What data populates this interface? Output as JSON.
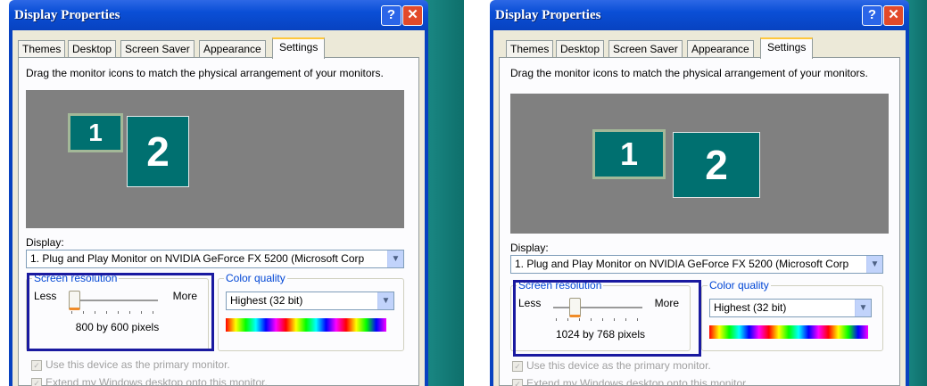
{
  "panels": [
    {
      "window": {
        "title": "Display Properties",
        "help_glyph": "?",
        "close_glyph": "✕"
      },
      "tabs": [
        "Themes",
        "Desktop",
        "Screen Saver",
        "Appearance",
        "Settings"
      ],
      "active_tab": "Settings",
      "instruction": "Drag the monitor icons to match the physical arrangement of your monitors.",
      "monitors": [
        "1",
        "2"
      ],
      "display_label": "Display:",
      "display_value": "1. Plug and Play Monitor on NVIDIA GeForce FX 5200  (Microsoft Corp",
      "screen_resolution": {
        "label": "Screen resolution",
        "less": "Less",
        "more": "More",
        "value": "800 by 600 pixels",
        "slider_fraction": 0.0
      },
      "color_quality": {
        "label": "Color quality",
        "value": "Highest (32 bit)"
      },
      "checkboxes": [
        "Use this device as the primary monitor.",
        "Extend my Windows desktop onto this monitor."
      ]
    },
    {
      "window": {
        "title": "Display Properties",
        "help_glyph": "?",
        "close_glyph": "✕"
      },
      "tabs": [
        "Themes",
        "Desktop",
        "Screen Saver",
        "Appearance",
        "Settings"
      ],
      "active_tab": "Settings",
      "instruction": "Drag the monitor icons to match the physical arrangement of your monitors.",
      "monitors": [
        "1",
        "2"
      ],
      "display_label": "Display:",
      "display_value": "1. Plug and Play Monitor on NVIDIA GeForce FX 5200  (Microsoft Corp",
      "screen_resolution": {
        "label": "Screen resolution",
        "less": "Less",
        "more": "More",
        "value": "1024 by 768 pixels",
        "slider_fraction": 0.2
      },
      "color_quality": {
        "label": "Color quality",
        "value": "Highest (32 bit)"
      },
      "checkboxes": [
        "Use this device as the primary monitor.",
        "Extend my Windows desktop onto this monitor."
      ]
    }
  ],
  "colors": {
    "titlebar": "#0a4fd6",
    "highlight": "#1a1aa0",
    "monitor": "#007070",
    "accent_label": "#0046d5"
  }
}
